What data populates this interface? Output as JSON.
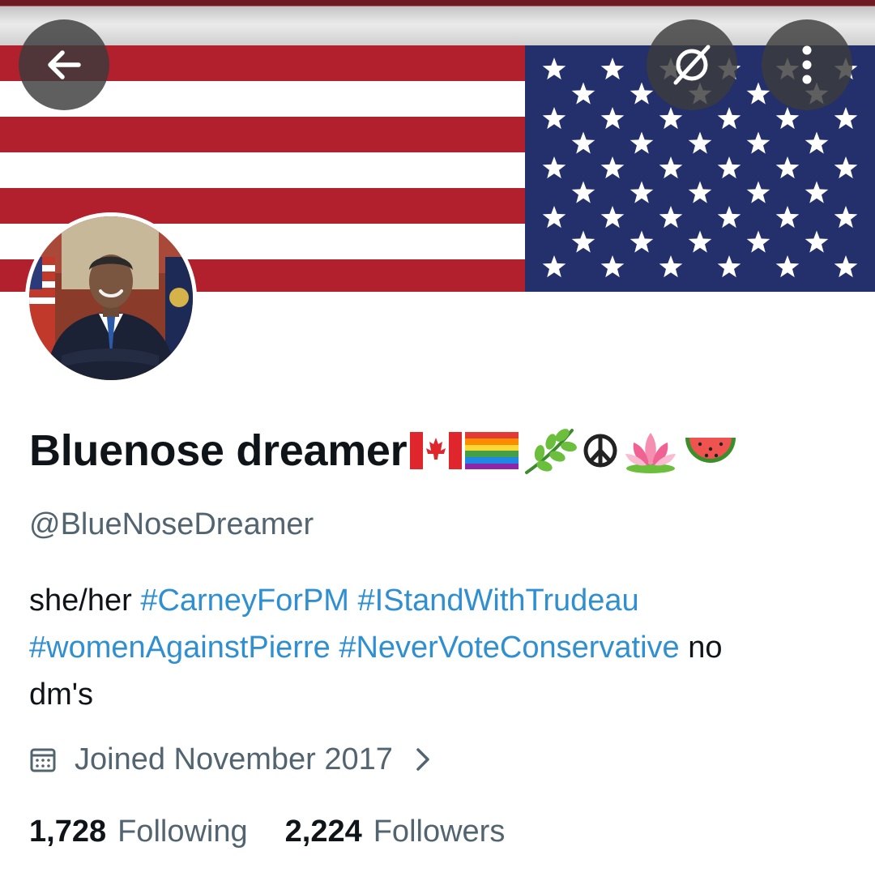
{
  "header": {
    "back_icon": "arrow-left-icon",
    "grok_icon": "grok-icon",
    "more_icon": "more-vertical-icon"
  },
  "banner": {
    "description": "",
    "stripe_red": "#b1202c",
    "canton_blue": "#23306b"
  },
  "profile": {
    "display_name": "Bluenose dreamer",
    "name_emojis": [
      "canada-flag",
      "rainbow-flag",
      "herb",
      "peace-symbol",
      "lotus",
      "watermelon"
    ],
    "handle": "@BlueNoseDreamer",
    "bio": {
      "line1_prefix": "she/her ",
      "hashtags": [
        "#CarneyForPM",
        "#IStandWithTrudeau",
        "#womenAgainstPierre",
        "#NeverVoteConservative"
      ],
      "suffix1": " no",
      "line3": "dm's"
    },
    "joined": "Joined November 2017",
    "following_count": "1,728",
    "following_label": "Following",
    "followers_count": "2,224",
    "followers_label": "Followers"
  },
  "colors": {
    "text_primary": "#0f1419",
    "text_secondary": "#536471",
    "link": "#2f8fd1"
  }
}
